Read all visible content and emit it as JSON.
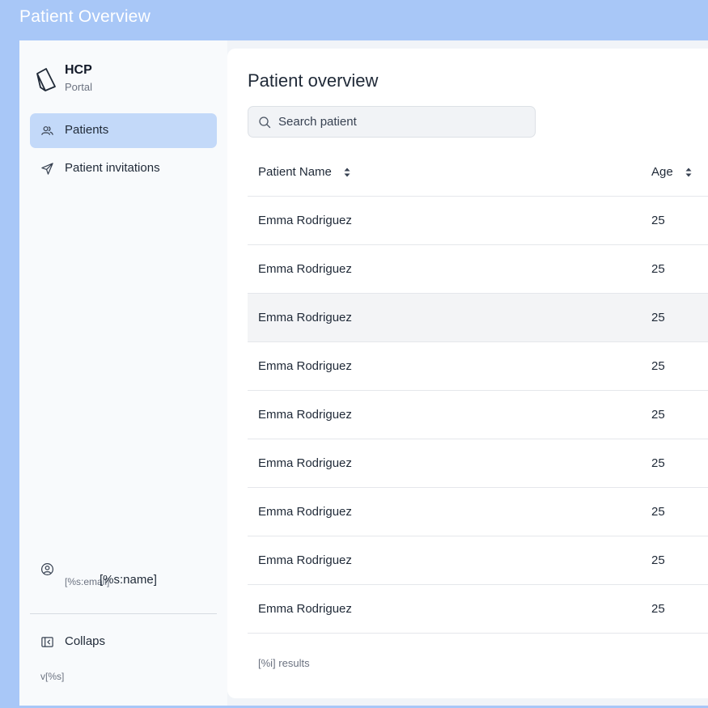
{
  "window": {
    "title": "Patient Overview"
  },
  "brand": {
    "name": "HCP",
    "subtitle": "Portal",
    "logo_icon": "box-logo-icon"
  },
  "sidebar": {
    "items": [
      {
        "label": "Patients",
        "icon": "users-icon",
        "active": true
      },
      {
        "label": "Patient invitations",
        "icon": "send-icon",
        "active": false
      }
    ],
    "user": {
      "email": "[%s:email]",
      "name": "[%s:name]",
      "icon": "user-circle-icon"
    },
    "collapse_label": "Collaps",
    "version": "v[%s]"
  },
  "main": {
    "title": "Patient overview",
    "search": {
      "placeholder": "Search patient",
      "value": ""
    },
    "table": {
      "columns": [
        "Patient Name",
        "Age"
      ],
      "rows": [
        {
          "name": "Emma Rodriguez",
          "age": "25"
        },
        {
          "name": "Emma Rodriguez",
          "age": "25"
        },
        {
          "name": "Emma Rodriguez",
          "age": "25"
        },
        {
          "name": "Emma Rodriguez",
          "age": "25"
        },
        {
          "name": "Emma Rodriguez",
          "age": "25"
        },
        {
          "name": "Emma Rodriguez",
          "age": "25"
        },
        {
          "name": "Emma Rodriguez",
          "age": "25"
        },
        {
          "name": "Emma Rodriguez",
          "age": "25"
        },
        {
          "name": "Emma Rodriguez",
          "age": "25"
        }
      ],
      "hovered_row": 2
    },
    "results_text": "[%i] results"
  },
  "colors": {
    "background": "#a8c7f7",
    "active_nav": "#c3d9f9",
    "sidebar": "#f8fafc",
    "card": "#ffffff"
  }
}
